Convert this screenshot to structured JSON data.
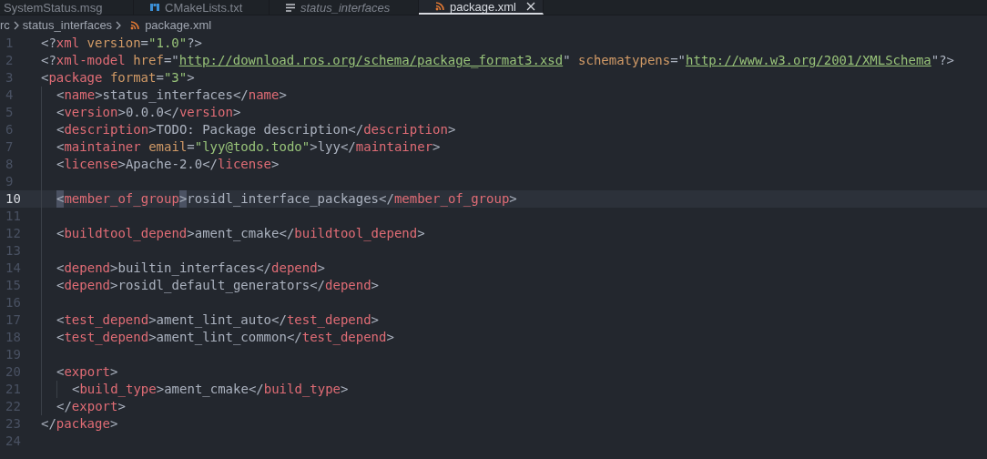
{
  "tabs": [
    {
      "label": "SystemStatus.msg",
      "selected": false,
      "preview": false,
      "kind": "message"
    },
    {
      "label": "CMakeLists.txt",
      "selected": false,
      "preview": false,
      "kind": "cmake"
    },
    {
      "label": "status_interfaces",
      "selected": false,
      "preview": true,
      "kind": "text"
    },
    {
      "label": "package.xml",
      "selected": true,
      "preview": false,
      "kind": "xml"
    }
  ],
  "breadcrumbs": [
    {
      "label": "rc",
      "kind": "folder"
    },
    {
      "label": "status_interfaces",
      "kind": "folder"
    },
    {
      "label": "package.xml",
      "kind": "xml"
    }
  ],
  "lines": [
    {
      "number": "1",
      "current": false,
      "tokens": [
        {
          "kind": "punct",
          "text": "<?"
        },
        {
          "kind": "tag",
          "text": "xml"
        },
        {
          "kind": "attr",
          "text": " version"
        },
        {
          "kind": "punct",
          "text": "="
        },
        {
          "kind": "string",
          "text": "\"1.0\""
        },
        {
          "kind": "punct",
          "text": "?>"
        }
      ]
    },
    {
      "number": "2",
      "current": false,
      "tokens": [
        {
          "kind": "punct",
          "text": "<?"
        },
        {
          "kind": "tag",
          "text": "xml-model"
        },
        {
          "kind": "attr",
          "text": " href"
        },
        {
          "kind": "punct",
          "text": "=\""
        },
        {
          "kind": "link",
          "text": "http://download.ros.org/schema/package_format3.xsd"
        },
        {
          "kind": "punct",
          "text": "\""
        },
        {
          "kind": "attr",
          "text": " schematypens"
        },
        {
          "kind": "punct",
          "text": "=\""
        },
        {
          "kind": "link",
          "text": "http://www.w3.org/2001/XMLSchema"
        },
        {
          "kind": "punct",
          "text": "\"?>"
        }
      ]
    },
    {
      "number": "3",
      "current": false,
      "tokens": [
        {
          "kind": "punct",
          "text": "<"
        },
        {
          "kind": "tag",
          "text": "package"
        },
        {
          "kind": "attr",
          "text": " format"
        },
        {
          "kind": "punct",
          "text": "="
        },
        {
          "kind": "string",
          "text": "\"3\""
        },
        {
          "kind": "punct",
          "text": ">"
        }
      ],
      "children": [
        {
          "number": "4",
          "current": false,
          "tokens": [
            {
              "kind": "punct",
              "text": "<"
            },
            {
              "kind": "tag",
              "text": "name"
            },
            {
              "kind": "punct",
              "text": ">"
            },
            {
              "kind": "text",
              "text": "status_interfaces"
            },
            {
              "kind": "punct",
              "text": "</"
            },
            {
              "kind": "tag",
              "text": "name"
            },
            {
              "kind": "punct",
              "text": ">"
            }
          ]
        },
        {
          "number": "5",
          "current": false,
          "tokens": [
            {
              "kind": "punct",
              "text": "<"
            },
            {
              "kind": "tag",
              "text": "version"
            },
            {
              "kind": "punct",
              "text": ">"
            },
            {
              "kind": "text",
              "text": "0.0.0"
            },
            {
              "kind": "punct",
              "text": "</"
            },
            {
              "kind": "tag",
              "text": "version"
            },
            {
              "kind": "punct",
              "text": ">"
            }
          ]
        },
        {
          "number": "6",
          "current": false,
          "tokens": [
            {
              "kind": "punct",
              "text": "<"
            },
            {
              "kind": "tag",
              "text": "description"
            },
            {
              "kind": "punct",
              "text": ">"
            },
            {
              "kind": "text",
              "text": "TODO: Package description"
            },
            {
              "kind": "punct",
              "text": "</"
            },
            {
              "kind": "tag",
              "text": "description"
            },
            {
              "kind": "punct",
              "text": ">"
            }
          ]
        },
        {
          "number": "7",
          "current": false,
          "tokens": [
            {
              "kind": "punct",
              "text": "<"
            },
            {
              "kind": "tag",
              "text": "maintainer"
            },
            {
              "kind": "attr",
              "text": " email"
            },
            {
              "kind": "punct",
              "text": "="
            },
            {
              "kind": "string",
              "text": "\"lyy@todo.todo\""
            },
            {
              "kind": "punct",
              "text": ">"
            },
            {
              "kind": "text",
              "text": "lyy"
            },
            {
              "kind": "punct",
              "text": "</"
            },
            {
              "kind": "tag",
              "text": "maintainer"
            },
            {
              "kind": "punct",
              "text": ">"
            }
          ]
        },
        {
          "number": "8",
          "current": false,
          "tokens": [
            {
              "kind": "punct",
              "text": "<"
            },
            {
              "kind": "tag",
              "text": "license"
            },
            {
              "kind": "punct",
              "text": ">"
            },
            {
              "kind": "text",
              "text": "Apache-2.0"
            },
            {
              "kind": "punct",
              "text": "</"
            },
            {
              "kind": "tag",
              "text": "license"
            },
            {
              "kind": "punct",
              "text": ">"
            }
          ]
        },
        {
          "number": "9",
          "current": false
        },
        {
          "number": "10",
          "current": true,
          "tokens": [
            {
              "kind": "bracket_match",
              "text": "<"
            },
            {
              "kind": "tag",
              "text": "member_of_group"
            },
            {
              "kind": "bracket_match",
              "text": ">"
            },
            {
              "kind": "text",
              "text": "rosidl_interface_packages"
            },
            {
              "kind": "punct",
              "text": "</"
            },
            {
              "kind": "tag",
              "text": "member_of_group"
            },
            {
              "kind": "punct",
              "text": ">"
            }
          ]
        },
        {
          "number": "11",
          "current": false
        },
        {
          "number": "12",
          "current": false,
          "tokens": [
            {
              "kind": "punct",
              "text": "<"
            },
            {
              "kind": "tag",
              "text": "buildtool_depend"
            },
            {
              "kind": "punct",
              "text": ">"
            },
            {
              "kind": "text",
              "text": "ament_cmake"
            },
            {
              "kind": "punct",
              "text": "</"
            },
            {
              "kind": "tag",
              "text": "buildtool_depend"
            },
            {
              "kind": "punct",
              "text": ">"
            }
          ]
        },
        {
          "number": "13",
          "current": false
        },
        {
          "number": "14",
          "current": false,
          "tokens": [
            {
              "kind": "punct",
              "text": "<"
            },
            {
              "kind": "tag",
              "text": "depend"
            },
            {
              "kind": "punct",
              "text": ">"
            },
            {
              "kind": "text",
              "text": "builtin_interfaces"
            },
            {
              "kind": "punct",
              "text": "</"
            },
            {
              "kind": "tag",
              "text": "depend"
            },
            {
              "kind": "punct",
              "text": ">"
            }
          ]
        },
        {
          "number": "15",
          "current": false,
          "tokens": [
            {
              "kind": "punct",
              "text": "<"
            },
            {
              "kind": "tag",
              "text": "depend"
            },
            {
              "kind": "punct",
              "text": ">"
            },
            {
              "kind": "text",
              "text": "rosidl_default_generators"
            },
            {
              "kind": "punct",
              "text": "</"
            },
            {
              "kind": "tag",
              "text": "depend"
            },
            {
              "kind": "punct",
              "text": ">"
            }
          ]
        },
        {
          "number": "16",
          "current": false
        },
        {
          "number": "17",
          "current": false,
          "tokens": [
            {
              "kind": "punct",
              "text": "<"
            },
            {
              "kind": "tag",
              "text": "test_depend"
            },
            {
              "kind": "punct",
              "text": ">"
            },
            {
              "kind": "text",
              "text": "ament_lint_auto"
            },
            {
              "kind": "punct",
              "text": "</"
            },
            {
              "kind": "tag",
              "text": "test_depend"
            },
            {
              "kind": "punct",
              "text": ">"
            }
          ]
        },
        {
          "number": "18",
          "current": false,
          "tokens": [
            {
              "kind": "punct",
              "text": "<"
            },
            {
              "kind": "tag",
              "text": "test_depend"
            },
            {
              "kind": "punct",
              "text": ">"
            },
            {
              "kind": "text",
              "text": "ament_lint_common"
            },
            {
              "kind": "punct",
              "text": "</"
            },
            {
              "kind": "tag",
              "text": "test_depend"
            },
            {
              "kind": "punct",
              "text": ">"
            }
          ]
        },
        {
          "number": "19",
          "current": false
        },
        {
          "number": "20",
          "current": false,
          "tokens": [
            {
              "kind": "punct",
              "text": "<"
            },
            {
              "kind": "tag",
              "text": "export"
            },
            {
              "kind": "punct",
              "text": ">"
            }
          ],
          "children": [
            {
              "number": "21",
              "current": false,
              "tokens": [
                {
                  "kind": "punct",
                  "text": "<"
                },
                {
                  "kind": "tag",
                  "text": "build_type"
                },
                {
                  "kind": "punct",
                  "text": ">"
                },
                {
                  "kind": "text",
                  "text": "ament_cmake"
                },
                {
                  "kind": "punct",
                  "text": "</"
                },
                {
                  "kind": "tag",
                  "text": "build_type"
                },
                {
                  "kind": "punct",
                  "text": ">"
                }
              ]
            }
          ]
        },
        {
          "number": "22",
          "current": false,
          "tokens": [
            {
              "kind": "punct",
              "text": "</"
            },
            {
              "kind": "tag",
              "text": "export"
            },
            {
              "kind": "punct",
              "text": ">"
            }
          ]
        }
      ]
    },
    {
      "number": "23",
      "current": false,
      "tokens": [
        {
          "kind": "punct",
          "text": "</"
        },
        {
          "kind": "tag",
          "text": "package"
        },
        {
          "kind": "punct",
          "text": ">"
        }
      ]
    },
    {
      "number": "24",
      "current": false
    }
  ]
}
